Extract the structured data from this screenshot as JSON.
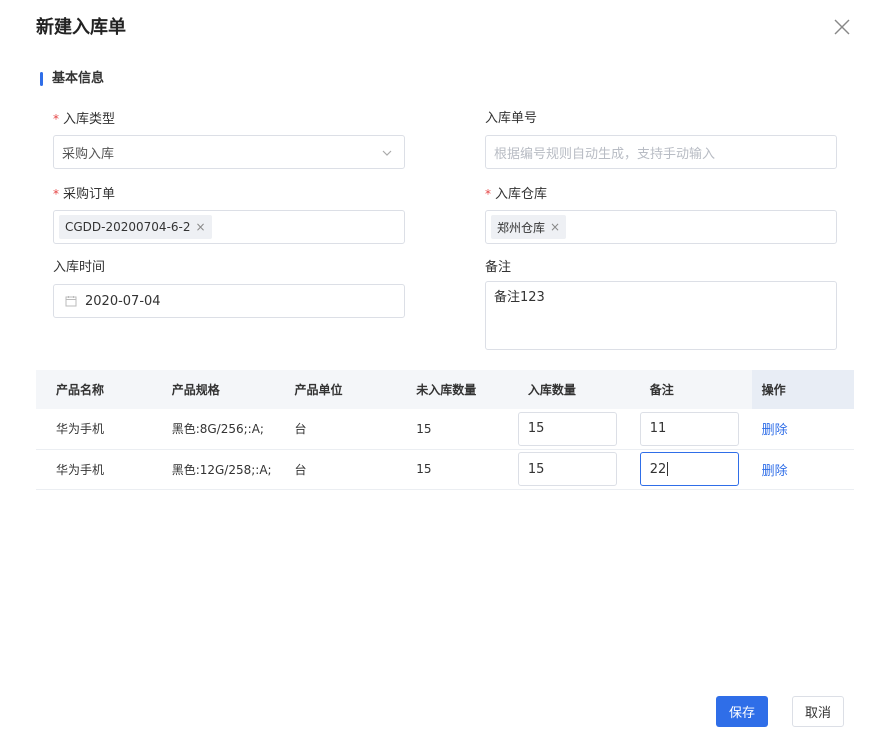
{
  "dialog": {
    "title": "新建入库单",
    "close_icon": "close-icon"
  },
  "section": {
    "title": "基本信息",
    "accent": "#2f6ee8"
  },
  "form": {
    "in_type": {
      "label": "入库类型",
      "value": "采购入库"
    },
    "in_no": {
      "label": "入库单号",
      "placeholder": "根据编号规则自动生成，支持手动输入"
    },
    "purchase_order": {
      "label": "采购订单",
      "tag": "CGDD-20200704-6-2"
    },
    "warehouse": {
      "label": "入库仓库",
      "tag": "郑州仓库"
    },
    "in_time": {
      "label": "入库时间",
      "value": "2020-07-04"
    },
    "remark": {
      "label": "备注",
      "value": "备注123"
    }
  },
  "table": {
    "columns": [
      "产品名称",
      "产品规格",
      "产品单位",
      "未入库数量",
      "入库数量",
      "备注",
      "操作"
    ],
    "rows": [
      {
        "name": "华为手机",
        "spec": "黑色:8G/256;:A;",
        "unit": "台",
        "pending": "15",
        "qty": "15",
        "remark": "11",
        "action": "删除"
      },
      {
        "name": "华为手机",
        "spec": "黑色:12G/258;:A;",
        "unit": "台",
        "pending": "15",
        "qty": "15",
        "remark": "22",
        "action": "删除"
      }
    ]
  },
  "footer": {
    "save_label": "保存",
    "cancel_label": "取消"
  }
}
